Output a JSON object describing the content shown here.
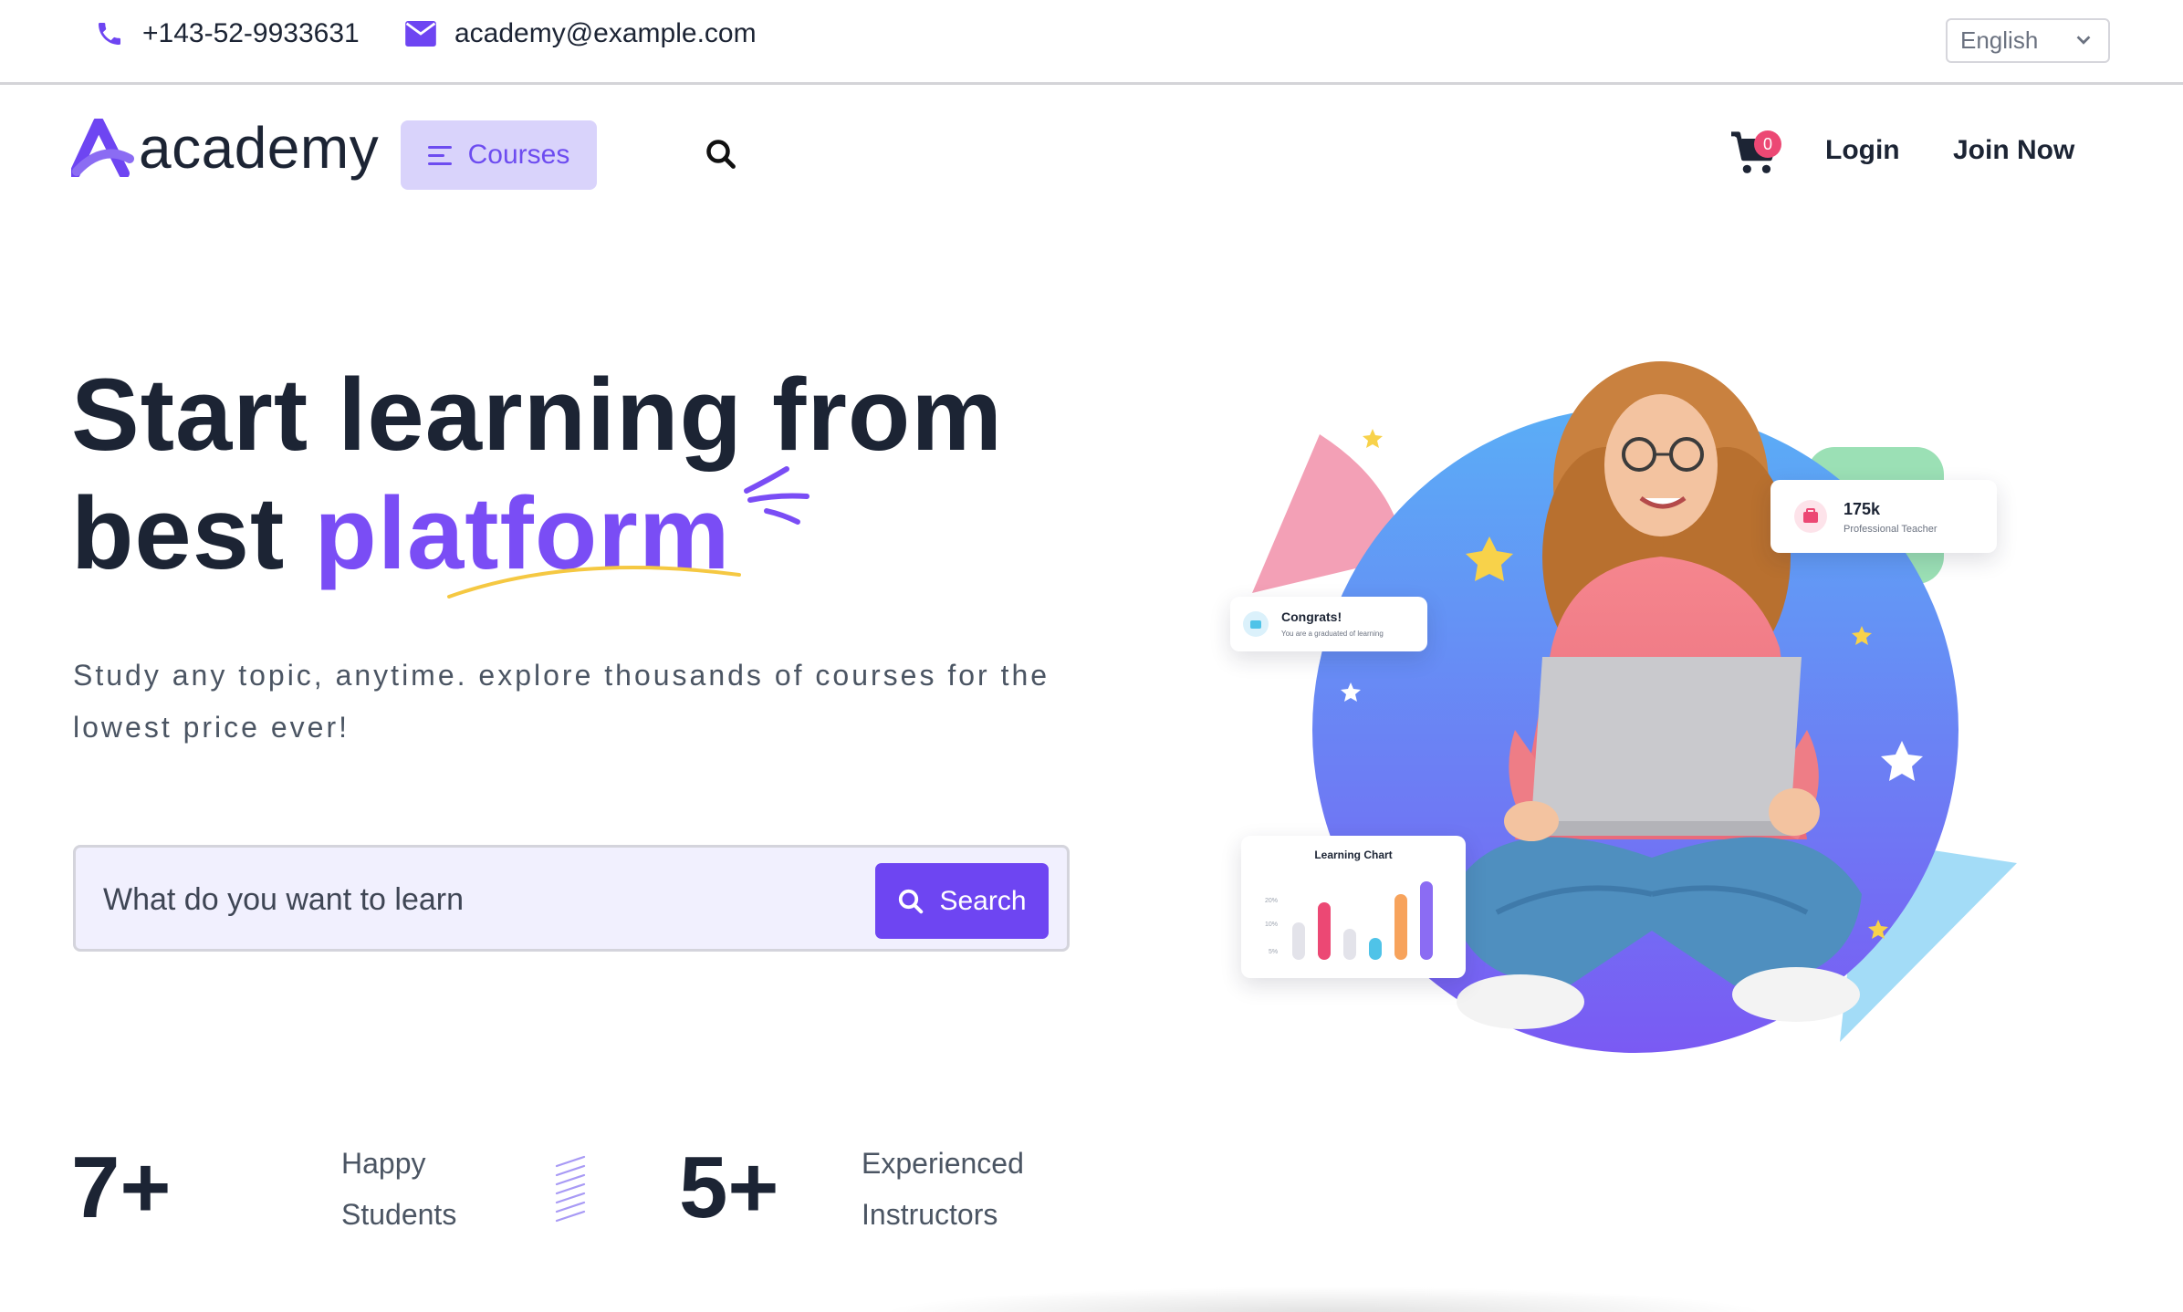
{
  "topbar": {
    "phone": "+143-52-9933631",
    "email": "academy@example.com",
    "language": "English"
  },
  "nav": {
    "logo_text": "academy",
    "courses_label": "Courses",
    "cart_count": "0",
    "login_label": "Login",
    "join_label": "Join Now"
  },
  "hero": {
    "headline_line1": "Start learning from",
    "headline_line2_plain": "best",
    "headline_line2_accent": "platform",
    "subtitle": "Study any topic, anytime. explore thousands of courses for the lowest price ever!",
    "search_placeholder": "What do you want to learn",
    "search_button": "Search"
  },
  "stats": [
    {
      "number": "7+",
      "label_line1": "Happy",
      "label_line2": "Students"
    },
    {
      "number": "5+",
      "label_line1": "Experienced",
      "label_line2": "Instructors"
    }
  ],
  "illustration": {
    "teacher_card": {
      "count": "175k",
      "label": "Professional Teacher"
    },
    "congrats_card": {
      "title": "Congrats!",
      "sub": "You are a graduated of learning"
    },
    "chart_card": {
      "title": "Learning Chart",
      "y_ticks": [
        "20%",
        "10%",
        "5%"
      ],
      "bars": [
        {
          "value": 0.45,
          "color": "#e3e3ea"
        },
        {
          "value": 0.7,
          "color": "#ec4874"
        },
        {
          "value": 0.38,
          "color": "#e3e3ea"
        },
        {
          "value": 0.27,
          "color": "#4fc3e8"
        },
        {
          "value": 0.8,
          "color": "#f7a35c"
        },
        {
          "value": 0.95,
          "color": "#8b6cf3"
        }
      ]
    }
  },
  "colors": {
    "primary": "#6e45f2",
    "accent_text": "#7a4df5",
    "dark": "#1c2434",
    "badge": "#ec4874"
  }
}
